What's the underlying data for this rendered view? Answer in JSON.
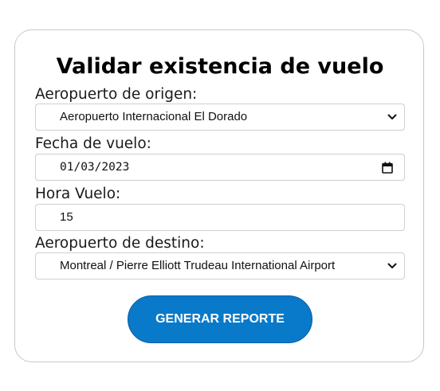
{
  "form": {
    "title": "Validar existencia de vuelo",
    "origin": {
      "label": "Aeropuerto de origen:",
      "value": "Aeropuerto Internacional El Dorado"
    },
    "date": {
      "label": "Fecha de vuelo:",
      "value": "01/03/2023"
    },
    "hour": {
      "label": "Hora Vuelo:",
      "value": "15"
    },
    "destination": {
      "label": "Aeropuerto de destino:",
      "value": "Montreal / Pierre Elliott Trudeau International Airport"
    },
    "submit_label": "GENERAR REPORTE"
  },
  "colors": {
    "button_bg": "#0979c9",
    "button_text": "#ffffff",
    "border": "#cfcfcf"
  },
  "icons": {
    "select_arrow": "chevron-down-icon",
    "date_picker": "calendar-icon"
  }
}
